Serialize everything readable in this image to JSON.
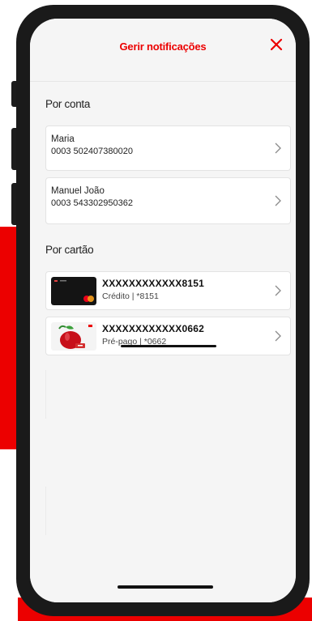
{
  "header": {
    "title": "Gerir notificações"
  },
  "sections": {
    "accounts_title": "Por conta",
    "cards_title": "Por cartão"
  },
  "accounts": [
    {
      "name": "Maria",
      "number": "0003 502407380020"
    },
    {
      "name": "Manuel João",
      "number": "0003 543302950362"
    }
  ],
  "cards": [
    {
      "number": "XXXXXXXXXXXX8151",
      "subtitle": "Crédito | *8151"
    },
    {
      "number": "XXXXXXXXXXXX0662",
      "subtitle": "Pré-pago | *0662"
    }
  ],
  "icons": {
    "close": "close-icon",
    "chevron": "chevron-right-icon"
  },
  "colors": {
    "brand": "#ec0000",
    "background": "#f5f5f5",
    "card": "#ffffff"
  }
}
